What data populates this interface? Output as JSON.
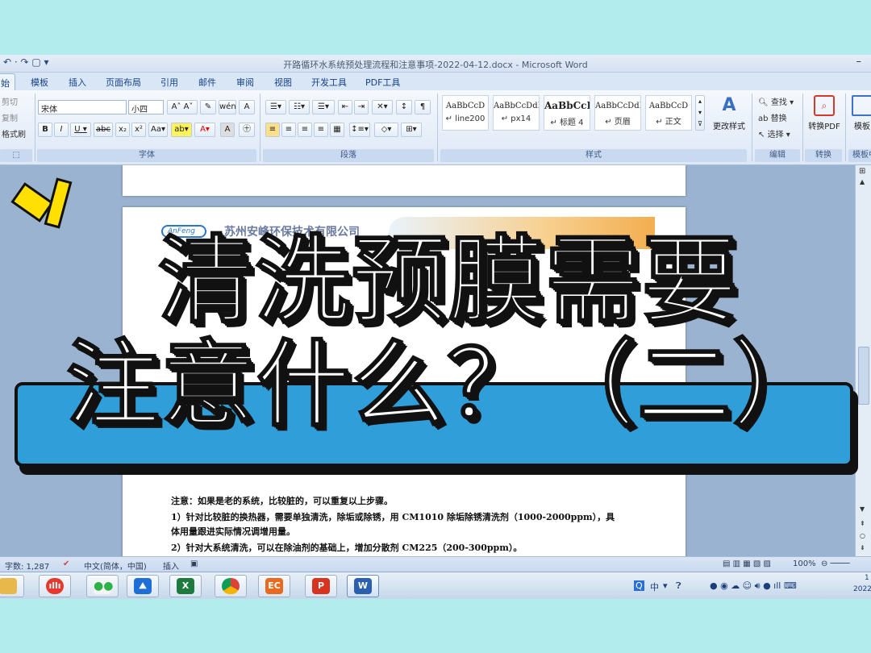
{
  "window": {
    "title": "开路循环水系统预处理流程和注意事项-2022-04-12.docx - Microsoft Word",
    "minimize_glyph": "–"
  },
  "ribbon_tabs": [
    "始",
    "模板",
    "插入",
    "页面布局",
    "引用",
    "邮件",
    "审阅",
    "视图",
    "开发工具",
    "PDF工具"
  ],
  "clipboard": {
    "cut": "剪切",
    "copy": "复制",
    "format_painter": "格式刷"
  },
  "font": {
    "name": "宋体",
    "size": "小四",
    "group_label": "字体"
  },
  "paragraph": {
    "group_label": "段落"
  },
  "styles": {
    "group_label": "样式",
    "tiles": [
      {
        "sample": "AaBbCcD",
        "name": "↵ line200"
      },
      {
        "sample": "AaBbCcDdI",
        "name": "↵ px14"
      },
      {
        "sample": "AaBbCcI",
        "name": "↵ 标题 4"
      },
      {
        "sample": "AaBbCcDdI",
        "name": "↵ 页眉"
      },
      {
        "sample": "AaBbCcD",
        "name": "↵ 正文"
      }
    ],
    "change_styles": "更改样式"
  },
  "editing": {
    "find": "查找",
    "replace": "替换",
    "select": "选择",
    "group_label": "编辑"
  },
  "convert": {
    "to_pdf": "转换PDF",
    "group_label": "转换"
  },
  "template": {
    "label": "模板",
    "group_label": "模板中"
  },
  "document": {
    "company": "苏州安峰环保技术有限公司",
    "logo": "AnFeng",
    "lines": [
      "注意：如果是老的系统，比较脏的，可以重复以上步骤。",
      "1）针对比较脏的换热器，需要单独清洗，除垢或除锈，用 CM1010 除垢除锈清洗剂（1000-2000ppm），具",
      "体用量跟进实际情况调增用量。",
      "2）针对大系统清洗，可以在除油剂的基础上，增加分散剂 CM225（200-300ppm）。"
    ]
  },
  "status_bar": {
    "word_count": "字数: 1,287",
    "language": "中文(简体，中国)",
    "mode": "插入",
    "zoom": "100%"
  },
  "taskbar": {
    "apps": [
      "folder",
      "voice",
      "wechat",
      "feishu",
      "excel",
      "chrome",
      "video",
      "pdf",
      "word"
    ],
    "tray_text": "中",
    "clock": "1",
    "date": "2022"
  },
  "overlay": {
    "line1": "清洗预膜需要",
    "line2": "注意什么？（二）"
  },
  "colors": {
    "overlay_bar": "#2f9ed9",
    "burst": "#ffe000",
    "background": "#b3ecec"
  }
}
